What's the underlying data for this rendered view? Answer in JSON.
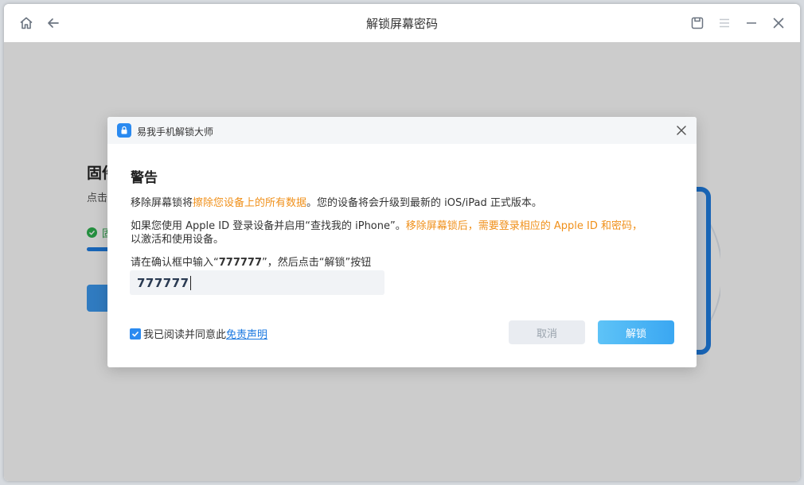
{
  "window": {
    "title": "解锁屏幕密码",
    "icons": [
      "home-icon",
      "back-arrow-icon",
      "feedback-icon",
      "menu-icon",
      "minimize-icon",
      "close-icon"
    ]
  },
  "background": {
    "title_partial": "固件",
    "subtitle_partial": "点击",
    "status_partial": "固",
    "progress": 1.0
  },
  "dialog": {
    "app_name": "易我手机解锁大师",
    "heading": "警告",
    "line1": {
      "prefix": "移除屏幕锁将",
      "highlight": "擦除您设备上的所有数据",
      "suffix": "。您的设备将会升级到最新的 iOS/iPad 正式版本。"
    },
    "line2": {
      "prefix": "如果您使用 Apple ID 登录设备并启用“查找我的 iPhone”。",
      "highlight": "移除屏幕锁后，需要登录相应的 Apple ID 和密码，",
      "second_line": "以激活和使用设备。"
    },
    "instruction": {
      "prefix": "请在确认框中输入“",
      "code": "777777",
      "suffix": "”，然后点击“解锁”按钮"
    },
    "input_value": "777777",
    "agree": {
      "checked": true,
      "text": "我已阅读并同意此",
      "link": "免责声明"
    },
    "cancel_label": "取消",
    "unlock_label": "解锁"
  },
  "colors": {
    "accent": "#2a8af0",
    "warning": "#f0901a",
    "overlay": "rgba(0,0,0,0.2)"
  }
}
